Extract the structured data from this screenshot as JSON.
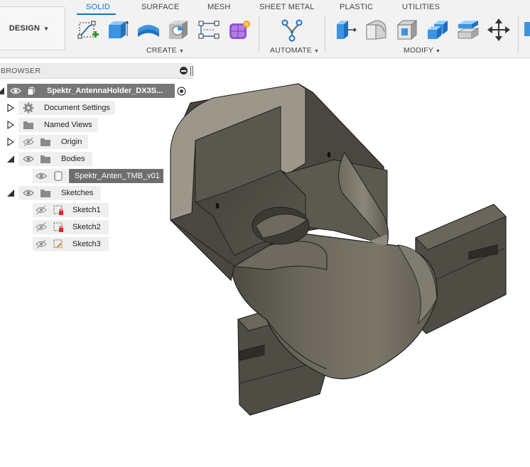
{
  "toolbar": {
    "workspace_label": "DESIGN",
    "tabs": [
      {
        "label": "SOLID",
        "active": true
      },
      {
        "label": "SURFACE",
        "active": false
      },
      {
        "label": "MESH",
        "active": false
      },
      {
        "label": "SHEET METAL",
        "active": false
      },
      {
        "label": "PLASTIC",
        "active": false
      },
      {
        "label": "UTILITIES",
        "active": false
      }
    ],
    "groups": {
      "create": "CREATE",
      "automate": "AUTOMATE",
      "modify": "MODIFY"
    },
    "create_tools": [
      "sketch-icon",
      "extrude-icon",
      "revolve-icon",
      "hole-icon",
      "pattern-icon",
      "form-icon"
    ],
    "automate_tools": [
      "automate-icon"
    ],
    "modify_tools": [
      "press-pull-icon",
      "fillet-icon",
      "shell-icon",
      "combine-icon",
      "offset-face-icon",
      "move-icon"
    ],
    "accent_color": "#0f72c6"
  },
  "browser": {
    "title": "BROWSER",
    "root": {
      "label": "Spektr_AntennaHolder_DX3S..."
    },
    "items": [
      {
        "label": "Document Settings"
      },
      {
        "label": "Named Views"
      },
      {
        "label": "Origin"
      },
      {
        "label": "Bodies"
      },
      {
        "label": "Spektr_Anten_TMB_v01"
      },
      {
        "label": "Sketches"
      },
      {
        "label": "Sketch1"
      },
      {
        "label": "Sketch2"
      },
      {
        "label": "Sketch3"
      }
    ]
  }
}
